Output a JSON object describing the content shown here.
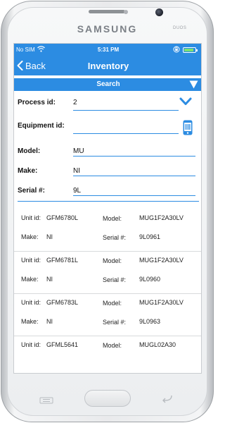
{
  "device": {
    "brand": "SAMSUNG",
    "sub_brand": "DUOS"
  },
  "status_bar": {
    "carrier": "No SIM",
    "time": "5:31 PM"
  },
  "nav": {
    "back_label": "Back",
    "title": "Inventory"
  },
  "search": {
    "label": "Search"
  },
  "form": {
    "process_id": {
      "label": "Process id:",
      "value": "2"
    },
    "equipment_id": {
      "label": "Equipment id:",
      "value": ""
    },
    "model": {
      "label": "Model:",
      "value": "MU"
    },
    "make": {
      "label": "Make:",
      "value": "NI"
    },
    "serial": {
      "label": "Serial #:",
      "value": "9L"
    }
  },
  "labels": {
    "unit_id": "Unit id:",
    "model": "Model:",
    "make": "Make:",
    "serial": "Serial #:"
  },
  "results": [
    {
      "unit_id": "GFM6780L",
      "model": "MUG1F2A30LV",
      "make": "NI",
      "serial": "9L0961"
    },
    {
      "unit_id": "GFM6781L",
      "model": "MUG1F2A30LV",
      "make": "NI",
      "serial": "9L0960"
    },
    {
      "unit_id": "GFM6783L",
      "model": "MUG1F2A30LV",
      "make": "NI",
      "serial": "9L0963"
    },
    {
      "unit_id": "GFML5641",
      "model": "MUGL02A30",
      "make": "",
      "serial": ""
    }
  ],
  "colors": {
    "accent": "#2c8ce2",
    "battery": "#7be26f"
  },
  "icons": [
    "chevron-left-icon",
    "wifi-icon",
    "lock-rotation-icon",
    "battery-icon",
    "triangle-down-icon",
    "chevron-down-icon",
    "barcode-scanner-icon"
  ]
}
